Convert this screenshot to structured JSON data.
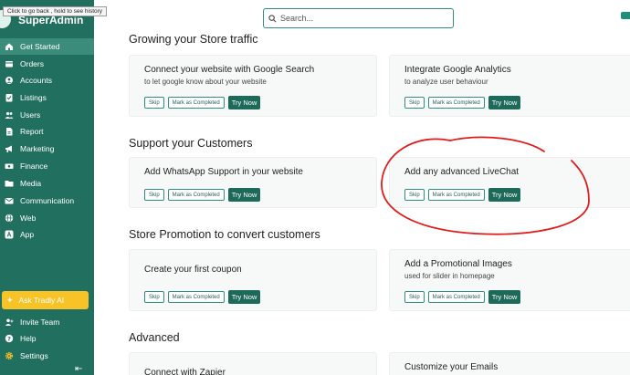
{
  "tooltip": "Click to go back , hold to see history",
  "brand": {
    "name": "SuperAdmin"
  },
  "sidebar": {
    "items": [
      {
        "label": "Get Started",
        "icon": "home-icon",
        "active": true
      },
      {
        "label": "Orders",
        "icon": "orders-icon"
      },
      {
        "label": "Accounts",
        "icon": "accounts-icon"
      },
      {
        "label": "Listings",
        "icon": "listings-icon"
      },
      {
        "label": "Users",
        "icon": "users-icon"
      },
      {
        "label": "Report",
        "icon": "report-icon"
      },
      {
        "label": "Marketing",
        "icon": "marketing-icon"
      },
      {
        "label": "Finance",
        "icon": "finance-icon"
      },
      {
        "label": "Media",
        "icon": "media-icon"
      },
      {
        "label": "Communication",
        "icon": "communication-icon"
      },
      {
        "label": "Web",
        "icon": "web-icon"
      },
      {
        "label": "App",
        "icon": "app-icon"
      }
    ],
    "ask": "Ask Tradly AI",
    "bottom": [
      {
        "label": "Invite Team",
        "icon": "invite-team-icon"
      },
      {
        "label": "Help",
        "icon": "help-icon"
      },
      {
        "label": "Settings",
        "icon": "settings-icon"
      }
    ]
  },
  "search": {
    "placeholder": "Search..."
  },
  "buttons": {
    "skip": "Skip",
    "mark": "Mark as Completed",
    "try": "Try Now"
  },
  "sections": [
    {
      "title": "Growing your Store traffic",
      "cards": [
        {
          "title": "Connect your website with Google Search",
          "subtitle": "to let google know about your website"
        },
        {
          "title": "Integrate Google Analytics",
          "subtitle": "to analyze user behaviour"
        }
      ]
    },
    {
      "title": "Support your Customers",
      "cards": [
        {
          "title": "Add WhatsApp Support in your website",
          "subtitle": ""
        },
        {
          "title": "Add any advanced LiveChat",
          "subtitle": ""
        }
      ]
    },
    {
      "title": "Store Promotion to convert customers",
      "cards": [
        {
          "title": "Create your first coupon",
          "subtitle": ""
        },
        {
          "title": "Add a Promotional Images",
          "subtitle": "used for slider in homepage"
        }
      ]
    },
    {
      "title": "Advanced",
      "cards": [
        {
          "title": "Connect with Zapier",
          "subtitle": ""
        },
        {
          "title": "Customize your Emails",
          "subtitle": ""
        }
      ]
    }
  ],
  "colors": {
    "sidebar": "#216f5f",
    "active": "#3b8c7b",
    "accent": "#1e6a5a",
    "ask": "#f7c326",
    "annotation": "#e01b1b"
  }
}
